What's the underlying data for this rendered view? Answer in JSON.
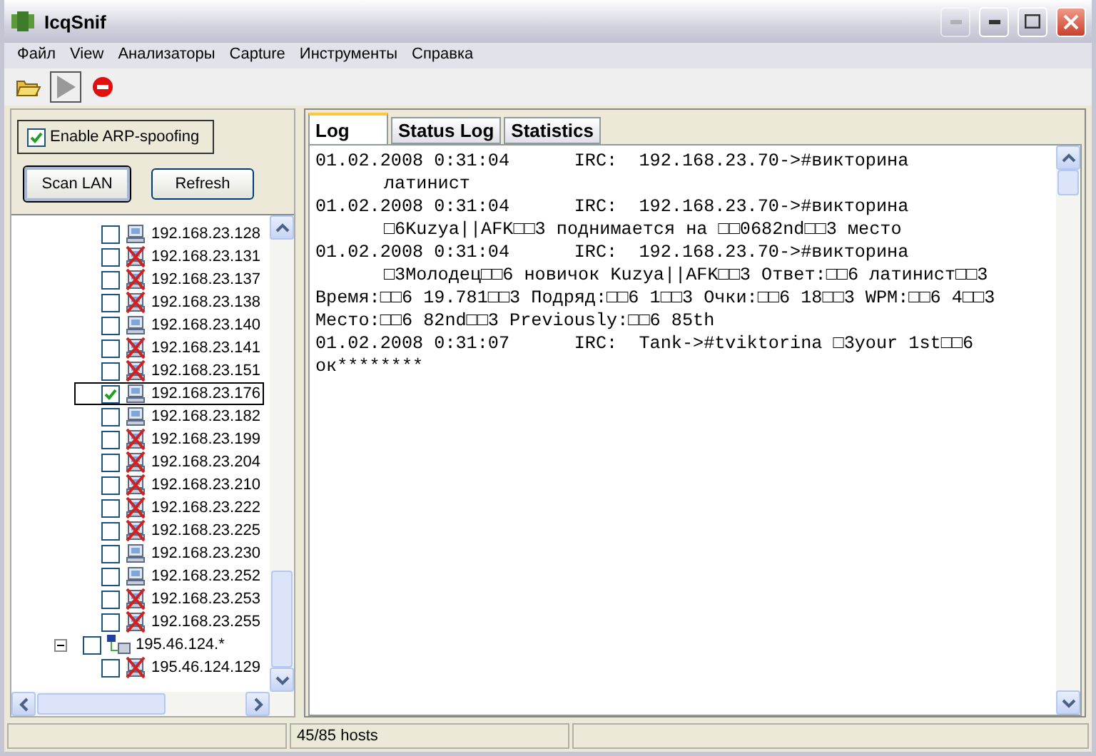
{
  "window": {
    "title": "IcqSnif"
  },
  "menu": [
    "Файл",
    "View",
    "Анализаторы",
    "Capture",
    "Инструменты",
    "Справка"
  ],
  "toolbar": {
    "play_disabled": true
  },
  "arp": {
    "label": "Enable ARP-spoofing",
    "checked": true
  },
  "buttons": [
    "Scan LAN",
    "Refresh"
  ],
  "tree": {
    "hosts": [
      {
        "ip": "192.168.23.128",
        "online": true,
        "checked": false,
        "selected": false
      },
      {
        "ip": "192.168.23.131",
        "online": false,
        "checked": false,
        "selected": false
      },
      {
        "ip": "192.168.23.137",
        "online": false,
        "checked": false,
        "selected": false
      },
      {
        "ip": "192.168.23.138",
        "online": false,
        "checked": false,
        "selected": false
      },
      {
        "ip": "192.168.23.140",
        "online": true,
        "checked": false,
        "selected": false
      },
      {
        "ip": "192.168.23.141",
        "online": false,
        "checked": false,
        "selected": false
      },
      {
        "ip": "192.168.23.151",
        "online": false,
        "checked": false,
        "selected": false
      },
      {
        "ip": "192.168.23.176",
        "online": true,
        "checked": true,
        "selected": true
      },
      {
        "ip": "192.168.23.182",
        "online": true,
        "checked": false,
        "selected": false
      },
      {
        "ip": "192.168.23.199",
        "online": false,
        "checked": false,
        "selected": false
      },
      {
        "ip": "192.168.23.204",
        "online": false,
        "checked": false,
        "selected": false
      },
      {
        "ip": "192.168.23.210",
        "online": false,
        "checked": false,
        "selected": false
      },
      {
        "ip": "192.168.23.222",
        "online": false,
        "checked": false,
        "selected": false
      },
      {
        "ip": "192.168.23.225",
        "online": false,
        "checked": false,
        "selected": false
      },
      {
        "ip": "192.168.23.230",
        "online": true,
        "checked": false,
        "selected": false
      },
      {
        "ip": "192.168.23.252",
        "online": true,
        "checked": false,
        "selected": false
      },
      {
        "ip": "192.168.23.253",
        "online": false,
        "checked": false,
        "selected": false
      },
      {
        "ip": "192.168.23.255",
        "online": false,
        "checked": false,
        "selected": false
      }
    ],
    "network": {
      "label": "195.46.124.*",
      "expanded": true,
      "checked": false,
      "children": [
        {
          "ip": "195.46.124.129",
          "online": false,
          "checked": false,
          "selected": false
        }
      ]
    }
  },
  "tabs": [
    {
      "label": "Log",
      "selected": true
    },
    {
      "label": "Status Log",
      "selected": false
    },
    {
      "label": "Statistics",
      "selected": false
    }
  ],
  "log": [
    {
      "text": "01.02.2008 0:31:04      IRC:  192.168.23.70->#викторина",
      "indent": false
    },
    {
      "text": "латинист",
      "indent": true
    },
    {
      "text": "01.02.2008 0:31:04      IRC:  192.168.23.70->#викторина",
      "indent": false
    },
    {
      "text": "□6Kuzya||AFK□□3 поднимается на □□0682nd□□3 место",
      "indent": true
    },
    {
      "text": "01.02.2008 0:31:04      IRC:  192.168.23.70->#викторина",
      "indent": false
    },
    {
      "text": "□3Молодец□□6 новичок Kuzya||AFK□□3 Ответ:□□6 латинист□□3",
      "indent": true
    },
    {
      "text": "Время:□□6 19.781□□3 Подряд:□□6 1□□3 Очки:□□6 18□□3 WPM:□□6 4□□3",
      "indent": false
    },
    {
      "text": "Место:□□6 82nd□□3 Previously:□□6 85th",
      "indent": false
    },
    {
      "text": "01.02.2008 0:31:07      IRC:  Tank->#tviktorina □3your 1st□□6",
      "indent": false
    },
    {
      "text": "ок********",
      "indent": false
    }
  ],
  "status_bar": [
    "45/85 hosts"
  ]
}
